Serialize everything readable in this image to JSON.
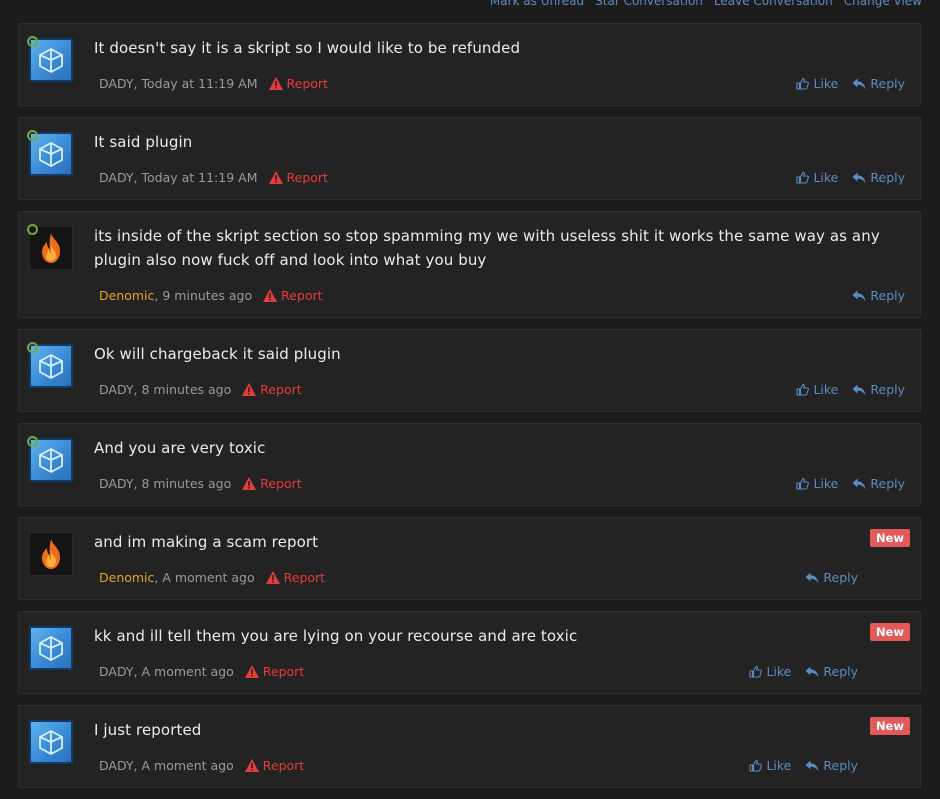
{
  "top_links": [
    "Mark as Unread",
    "Star Conversation",
    "Leave Conversation",
    "Change View"
  ],
  "report_label": "Report",
  "like_label": "Like",
  "reply_label": "Reply",
  "new_label": "New",
  "messages": [
    {
      "text": "It doesn't say it is a skript so I would like to be refunded",
      "author": "DADY",
      "time": ", Today at 11:19 AM"
    },
    {
      "text": "It said plugin",
      "author": "DADY",
      "time": ", Today at 11:19 AM"
    },
    {
      "text": "its inside of the skript section so stop spamming my we with useless shit it works the same way as any plugin also now fuck off and look into what you buy",
      "author": "Denomic",
      "time": ", 9 minutes ago"
    },
    {
      "text": "Ok will chargeback it said plugin",
      "author": "DADY",
      "time": ", 8 minutes ago"
    },
    {
      "text": "And you are very toxic",
      "author": "DADY",
      "time": ", 8 minutes ago"
    },
    {
      "text": "and im making a scam report",
      "author": "Denomic",
      "time": ", A moment ago"
    },
    {
      "text": "kk and ill tell them you are lying on your recourse and are toxic",
      "author": "DADY",
      "time": ", A moment ago"
    },
    {
      "text": "I just reported",
      "author": "DADY",
      "time": ", A moment ago"
    }
  ]
}
